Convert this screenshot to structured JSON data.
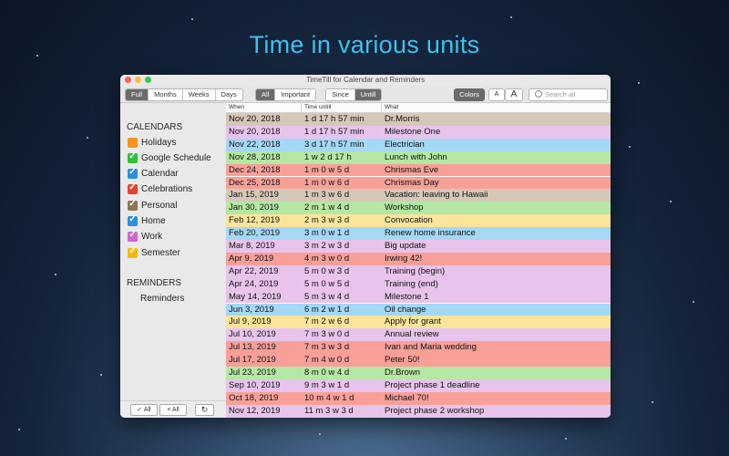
{
  "headline": "Time in various units",
  "window": {
    "title": "TimeTill for Calendar and Reminders"
  },
  "toolbar": {
    "range_tabs": [
      "Full",
      "Months",
      "Weeks",
      "Days"
    ],
    "range_selected": 0,
    "filter_tabs": [
      "All",
      "Important"
    ],
    "filter_selected": 0,
    "time_tabs": [
      "Since",
      "Untill"
    ],
    "time_selected": 1,
    "colors_label": "Colors",
    "font_small": "A",
    "font_large": "A",
    "search_placeholder": "Search all"
  },
  "sidebar": {
    "calendars_header": "CALENDARS",
    "calendars": [
      {
        "name": "Holidays",
        "color": "#f7941d",
        "checked": false
      },
      {
        "name": "Google Schedule",
        "color": "#2fbf3a",
        "checked": true
      },
      {
        "name": "Calendar",
        "color": "#2a8fe0",
        "checked": true
      },
      {
        "name": "Celebrations",
        "color": "#e8412c",
        "checked": true
      },
      {
        "name": "Personal",
        "color": "#8c7457",
        "checked": true
      },
      {
        "name": "Home",
        "color": "#2a8fe0",
        "checked": true
      },
      {
        "name": "Work",
        "color": "#cf63cf",
        "checked": true
      },
      {
        "name": "Semester",
        "color": "#f5b800",
        "checked": true
      }
    ],
    "reminders_header": "REMINDERS",
    "reminders": [
      "Reminders"
    ],
    "check_all": "✓ All",
    "uncheck_all": "× All",
    "refresh_icon": "refresh-icon"
  },
  "table": {
    "columns": [
      "When",
      "Time untill",
      "What"
    ],
    "rows": [
      {
        "when": "Nov 20, 2018",
        "time": "1 d 17 h 57 min",
        "what": "Dr.Morris",
        "color": "#d6c8b6"
      },
      {
        "when": "Nov 20, 2018",
        "time": "1 d 17 h 57 min",
        "what": "Milestone One",
        "color": "#e8c4ec"
      },
      {
        "when": "Nov 22, 2018",
        "time": "3 d 17 h 57 min",
        "what": "Electrician",
        "color": "#a4d8f5"
      },
      {
        "when": "Nov 28, 2018",
        "time": "1 w 2 d 17 h",
        "what": "Lunch with John",
        "color": "#b4e8a4"
      },
      {
        "when": "Dec 24, 2018",
        "time": "1 m 0 w 5 d",
        "what": "Chrismas Eve",
        "color": "#f8a098"
      },
      {
        "when": "Dec 25, 2018",
        "time": "1 m 0 w 6 d",
        "what": "Chrismas Day",
        "color": "#f8a098"
      },
      {
        "when": "Jan 15, 2019",
        "time": "1 m 3 w 6 d",
        "what": "Vacation: leaving to Hawaii",
        "color": "#d6c8b6"
      },
      {
        "when": "Jan 30, 2019",
        "time": "2 m 1 w 4 d",
        "what": "Workshop",
        "color": "#b4e8a4"
      },
      {
        "when": "Feb 12, 2019",
        "time": "2 m 3 w 3 d",
        "what": "Convocation",
        "color": "#fce49a"
      },
      {
        "when": "Feb 20, 2019",
        "time": "3 m 0 w 1 d",
        "what": "Renew home insurance",
        "color": "#a4d8f5"
      },
      {
        "when": "Mar 8, 2019",
        "time": "3 m 2 w 3 d",
        "what": "Big update",
        "color": "#e8c4ec"
      },
      {
        "when": "Apr 9, 2019",
        "time": "4 m 3 w 0 d",
        "what": "Irwing 42!",
        "color": "#f8a098"
      },
      {
        "when": "Apr 22, 2019",
        "time": "5 m 0 w 3 d",
        "what": "Training (begin)",
        "color": "#e8c4ec"
      },
      {
        "when": "Apr 24, 2019",
        "time": "5 m 0 w 5 d",
        "what": "Training (end)",
        "color": "#e8c4ec"
      },
      {
        "when": "May 14, 2019",
        "time": "5 m 3 w 4 d",
        "what": "Milestone 1",
        "color": "#e8c4ec"
      },
      {
        "when": "Jun 3, 2019",
        "time": "6 m 2 w 1 d",
        "what": "Oil change",
        "color": "#a4d8f5"
      },
      {
        "when": "Jul 9, 2019",
        "time": "7 m 2 w 6 d",
        "what": "Apply for grant",
        "color": "#fce49a"
      },
      {
        "when": "Jul 10, 2019",
        "time": "7 m 3 w 0 d",
        "what": "Annual review",
        "color": "#e8c4ec"
      },
      {
        "when": "Jul 13, 2019",
        "time": "7 m 3 w 3 d",
        "what": "Ivan and Maria wedding",
        "color": "#f8a098"
      },
      {
        "when": "Jul 17, 2019",
        "time": "7 m 4 w 0 d",
        "what": "Peter 50!",
        "color": "#f8a098"
      },
      {
        "when": "Jul 23, 2019",
        "time": "8 m 0 w 4 d",
        "what": "Dr.Brown",
        "color": "#b4e8a4"
      },
      {
        "when": "Sep 10, 2019",
        "time": "9 m 3 w 1 d",
        "what": "Project phase 1 deadline",
        "color": "#e8c4ec"
      },
      {
        "when": "Oct 18, 2019",
        "time": "10 m 4 w 1 d",
        "what": "Michael 70!",
        "color": "#f8a098"
      },
      {
        "when": "Nov 12, 2019",
        "time": "11 m 3 w 3 d",
        "what": "Project phase 2 workshop",
        "color": "#e8c4ec"
      }
    ]
  }
}
